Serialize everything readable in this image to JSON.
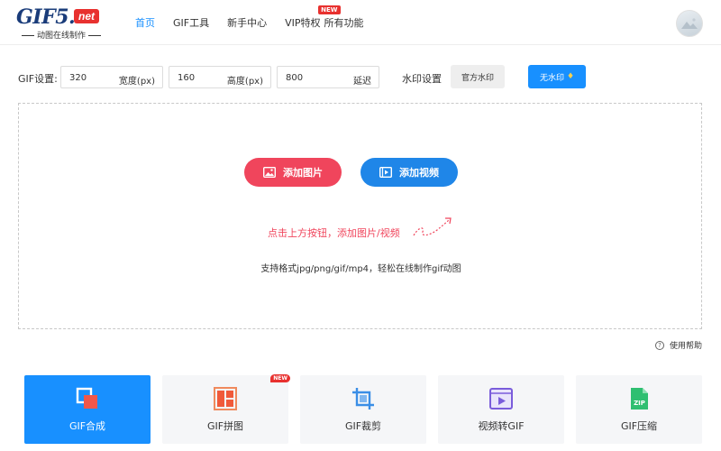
{
  "header": {
    "logo_main": "GIF5.",
    "logo_net": "net",
    "logo_sub": "动图在线制作",
    "nav": [
      {
        "label": "首页"
      },
      {
        "label": "GIF工具"
      },
      {
        "label": "新手中心"
      },
      {
        "label": "VIP特权",
        "badge": "NEW"
      },
      {
        "label": "所有功能"
      }
    ]
  },
  "settings": {
    "gif_label": "GIF设置:",
    "width": {
      "value": "320",
      "unit": "宽度(px)"
    },
    "height": {
      "value": "160",
      "unit": "高度(px)"
    },
    "delay": {
      "value": "800",
      "unit": "延迟"
    },
    "watermark_label": "水印设置",
    "official_watermark": "官方水印",
    "no_watermark": "无水印"
  },
  "upload": {
    "add_image": "添加图片",
    "add_video": "添加视频",
    "hint": "点击上方按钮，添加图片/视频",
    "formats": "支持格式jpg/png/gif/mp4，轻松在线制作gif动图"
  },
  "help": {
    "label": "使用帮助"
  },
  "tools": [
    {
      "label": "GIF合成",
      "active": true
    },
    {
      "label": "GIF拼图",
      "badge": "NEW"
    },
    {
      "label": "GIF裁剪"
    },
    {
      "label": "视频转GIF"
    },
    {
      "label": "GIF压缩"
    }
  ],
  "colors": {
    "accent": "#1890ff",
    "red": "#f0455c",
    "video_blue": "#1f86e8",
    "badge_red": "#e8312f"
  }
}
